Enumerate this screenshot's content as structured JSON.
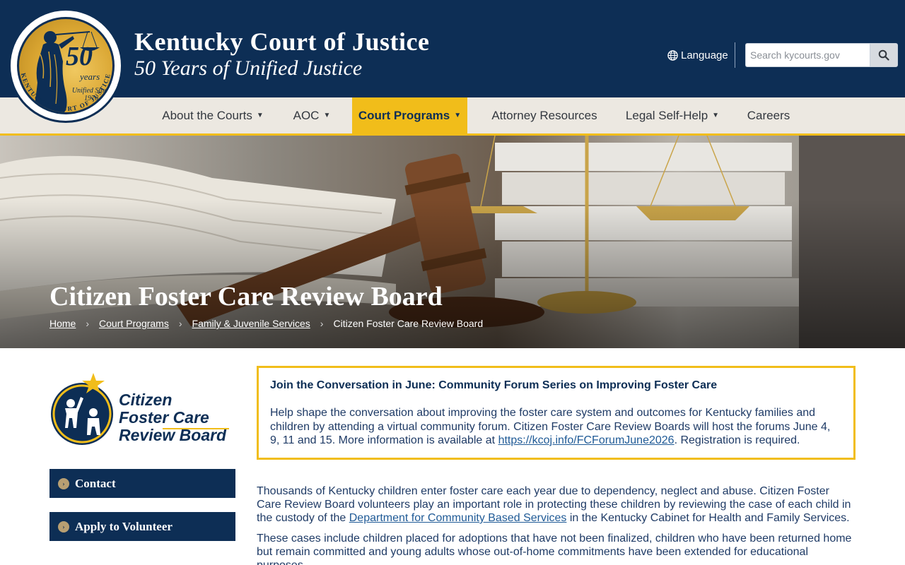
{
  "header": {
    "title": "Kentucky Court of Justice",
    "subtitle": "50 Years of Unified Justice",
    "seal": {
      "ring_text": "KENTUCKY COURT OF JUSTICE",
      "number": "50",
      "years": "years",
      "since_line1": "Unified Since",
      "since_line2": "1976"
    },
    "language_label": "Language",
    "search_placeholder": "Search kycourts.gov"
  },
  "nav": {
    "items": [
      {
        "label": "About the Courts",
        "has_dropdown": true
      },
      {
        "label": "AOC",
        "has_dropdown": true
      },
      {
        "label": "Court Programs",
        "has_dropdown": true,
        "active": true
      },
      {
        "label": "Attorney Resources",
        "has_dropdown": false
      },
      {
        "label": "Legal Self-Help",
        "has_dropdown": true
      },
      {
        "label": "Careers",
        "has_dropdown": false
      }
    ]
  },
  "hero": {
    "title": "Citizen Foster Care Review Board",
    "breadcrumbs": [
      "Home",
      "Court Programs",
      "Family & Juvenile Services"
    ],
    "current": "Citizen Foster Care Review Board"
  },
  "sidebar": {
    "logo_lines": [
      "Citizen",
      "Foster Care",
      "Review Board"
    ],
    "buttons": [
      {
        "label": "Contact"
      },
      {
        "label": "Apply to Volunteer"
      }
    ]
  },
  "notice": {
    "heading": "Join the Conversation in June: Community Forum Series on Improving Foster Care",
    "text_before": "Help shape the conversation about improving the foster care system and outcomes for Kentucky families and children by attending a virtual community forum. Citizen Foster Care Review Boards will host the forums June 4, 9, 11 and 15. More information is available at ",
    "link": "https://kcoj.info/FCForumJune2026",
    "text_after": ". Registration is required."
  },
  "body": {
    "p1_before": "Thousands of Kentucky children enter foster care each year due to dependency, neglect and abuse. Citizen Foster Care Review Board volunteers play an important role in protecting these children by reviewing the case of each child in the custody of the ",
    "p1_link": "Department for Community Based Services",
    "p1_after": " in the Kentucky Cabinet for Health and Family Services.",
    "p2": "These cases include children placed for adoptions that have not been finalized, children who have been returned home but remain committed and young adults whose out-of-home commitments have been extended for educational purposes."
  },
  "colors": {
    "navy": "#0d2e55",
    "gold": "#f1bd1a",
    "nav_bg": "#ece8e1"
  }
}
